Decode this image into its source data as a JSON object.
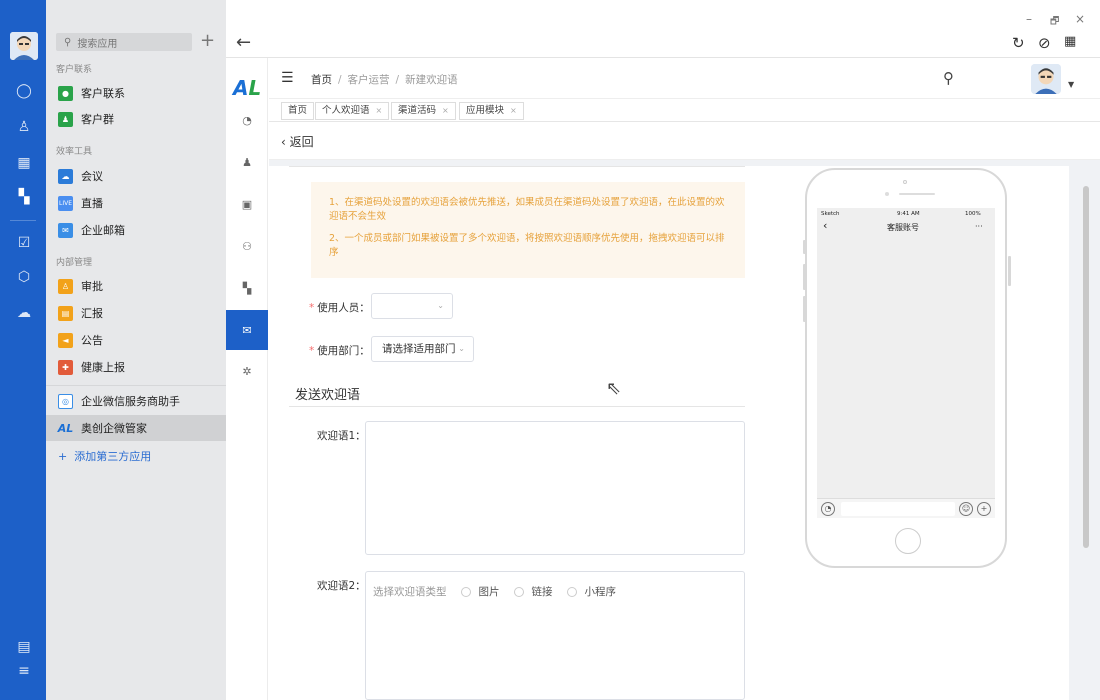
{
  "sidebar": {
    "search_placeholder": "搜索应用",
    "add": "+",
    "groups": [
      "客户联系",
      "效率工具",
      "内部管理"
    ],
    "items": [
      {
        "label": "客户联系",
        "color": "#2aa34a"
      },
      {
        "label": "客户群",
        "color": "#2aa34a"
      },
      {
        "label": "会议",
        "color": "#2b7bd8"
      },
      {
        "label": "直播",
        "color": "#4a8ef0"
      },
      {
        "label": "企业邮箱",
        "color": "#3a8ee6"
      },
      {
        "label": "审批",
        "color": "#f2a21a"
      },
      {
        "label": "汇报",
        "color": "#f2a21a"
      },
      {
        "label": "公告",
        "color": "#f2a21a"
      },
      {
        "label": "健康上报",
        "color": "#e25b3a"
      },
      {
        "label": "企业微信服务商助手",
        "color": "#3a8ee6"
      },
      {
        "label": "奥创企微管家",
        "color": "#1a6fd5"
      }
    ],
    "add_third_party": "添加第三方应用"
  },
  "window": {
    "minimize": "–",
    "restore": "🗗",
    "close": "×"
  },
  "header": {
    "breadcrumb": [
      "首页",
      "客户运营",
      "新建欢迎语"
    ]
  },
  "tags": [
    {
      "label": "首页"
    },
    {
      "label": "个人欢迎语"
    },
    {
      "label": "渠道活码"
    },
    {
      "label": "应用模块"
    }
  ],
  "back_label": "返回",
  "notice": {
    "line1": "1、在渠道码处设置的欢迎语会被优先推送，如果成员在渠道码处设置了欢迎语，在此设置的欢迎语不会生效",
    "line2": "2、一个成员或部门如果被设置了多个欢迎语，将按照欢迎语顺序优先使用，拖拽欢迎语可以排序"
  },
  "form": {
    "user_label": "使用人员：",
    "dept_label": "使用部门：",
    "dept_placeholder": "请选择适用部门",
    "section_title": "发送欢迎语",
    "greeting1_label": "欢迎语1：",
    "greeting2_label": "欢迎语2：",
    "type_prompt": "选择欢迎语类型",
    "types": [
      "图片",
      "链接",
      "小程序"
    ]
  },
  "phone": {
    "carrier": "Sketch",
    "time": "9:41 AM",
    "battery": "100%",
    "title": "客服账号",
    "back": "‹",
    "more": "···"
  }
}
